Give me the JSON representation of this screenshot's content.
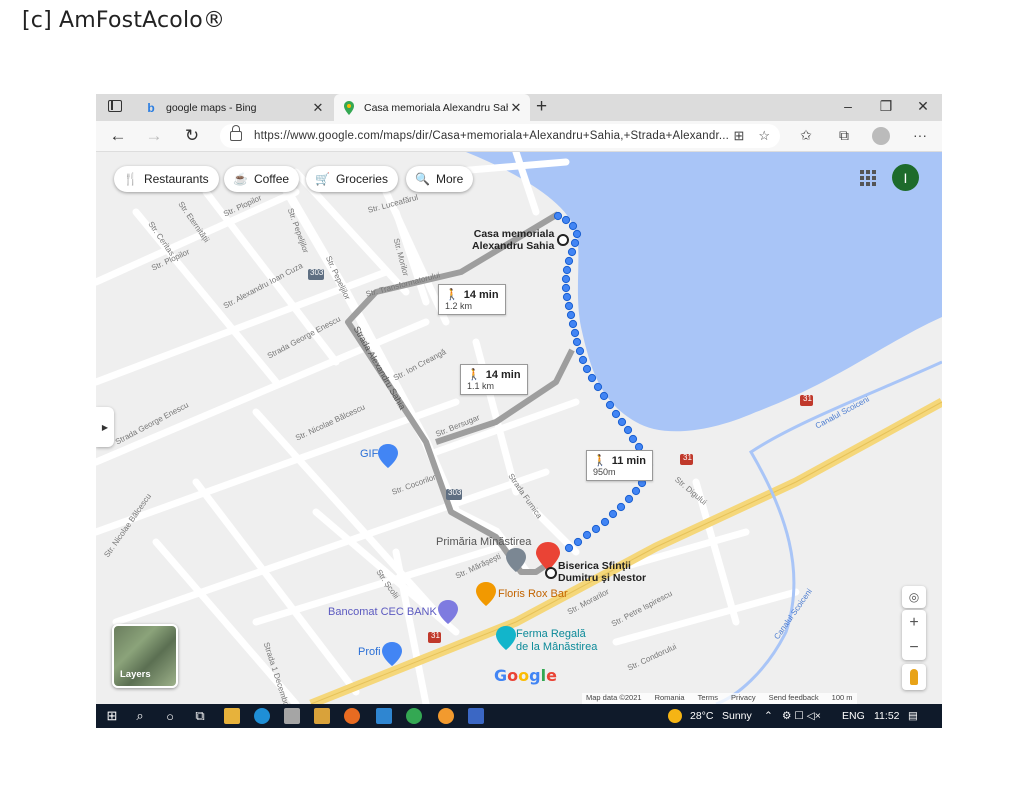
{
  "watermark": "[c] AmFostAcolo®",
  "browser": {
    "tabs": [
      {
        "title": "google maps - Bing",
        "favicon": "bing-icon"
      },
      {
        "title": "Casa memoriala Alexandru Sahia",
        "favicon": "google-maps-pin-icon"
      }
    ],
    "address": "https://www.google.com/maps/dir/Casa+memoriala+Alexandru+Sahia,+Strada+Alexandr..."
  },
  "map": {
    "chips": [
      {
        "label": "Restaurants",
        "icon": "fork-knife-icon"
      },
      {
        "label": "Coffee",
        "icon": "coffee-icon"
      },
      {
        "label": "Groceries",
        "icon": "cart-icon"
      },
      {
        "label": "More",
        "icon": "search-icon"
      }
    ],
    "account_initial": "I",
    "origin": {
      "line1": "Casa memoriala",
      "line2": "Alexandru Sahia"
    },
    "destination": {
      "line1": "Biserica Sfinţii",
      "line2": "Dumitru şi Nestor"
    },
    "routes": [
      {
        "time": "14 min",
        "distance": "1.2 km"
      },
      {
        "time": "14 min",
        "distance": "1.1 km"
      },
      {
        "time": "11 min",
        "distance": "950m"
      }
    ],
    "places": {
      "primaria": "Primăria Mînăstirea",
      "floris": "Floris Rox Bar",
      "bancomat": "Bancomat CEC BANK",
      "ferma_line1": "Ferma Regală",
      "ferma_line2": "de la Mânăstirea",
      "profi": "Profi",
      "gif": "GIF"
    },
    "streets": {
      "plopilor": "Str. Plopilor",
      "plopilor2": "Str. Plopilor",
      "ceritas": "Str. Ceritas",
      "eternitatii": "Str. Eternității",
      "luceafarul": "Str. Luceafărul",
      "morilor": "Str. Morilor",
      "pepeljilor": "Str. Pepeljilor",
      "pepeljilor2": "Str. Pepeljilor",
      "transformatorului": "Str. Transformatorului",
      "ioan_cuza": "Str. Alexandru Ioan Cuza",
      "george_enescu": "Strada George Enescu",
      "george_enescu2": "Strada George Enescu",
      "ion_creanga": "Str. Ion Creangă",
      "balcescu": "Str. Nicolae Bălcescu",
      "balcescu2": "Str. Nicolae Bălcescu",
      "alexandru_sahia": "Strada Alexandru Sahia",
      "tei_sugar": "Str. Bersugar",
      "cocorilor": "Str. Cocorilor",
      "furnica": "Strada Furnica",
      "marasesti": "Str. Mărășești",
      "scolii": "Str. Școlii",
      "morarilor": "Str. Morarilor",
      "petre_ispirescu": "Str. Petre Ispirescu",
      "condorului": "Str. Condorului",
      "digului": "Str. Digului",
      "decembrie": "Strada 1 Decembrie",
      "canal1": "Canalul Scoiceni",
      "canal2": "Canalul Scoiceni",
      "rutier303": "303",
      "rutier303b": "303",
      "rutier31": "31",
      "rutier31b": "31",
      "rutier31c": "31"
    },
    "controls": {
      "layers": "Layers",
      "zoom_in": "+",
      "zoom_out": "−"
    },
    "google": "Google",
    "footer": [
      "Map data ©2021",
      "Romania",
      "Terms",
      "Privacy",
      "Send feedback",
      "100 m"
    ]
  },
  "taskbar": {
    "temperature": "28°C",
    "weather": "Sunny",
    "language": "ENG",
    "time": "11:52"
  },
  "colors": {
    "water": "#a9c5f7",
    "route_dot": "#4285f4",
    "main_road": "#f5d77a",
    "alt_route": "#9e9e9e",
    "taskbar": "#0f1a2a"
  }
}
